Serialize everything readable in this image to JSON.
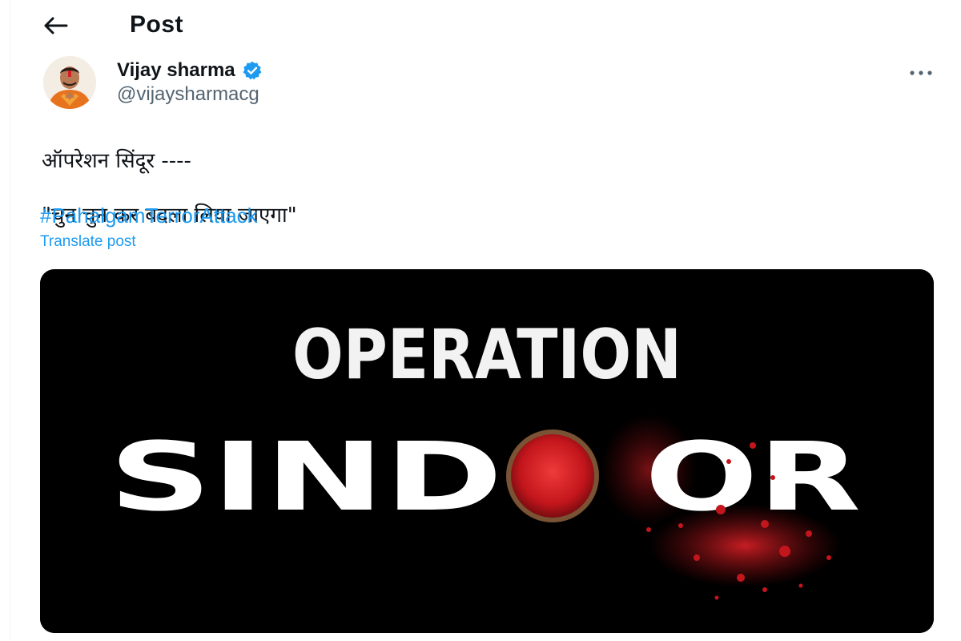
{
  "header": {
    "title": "Post",
    "back_icon": "arrow-left-icon"
  },
  "author": {
    "name": "Vijay sharma",
    "handle": "@vijaysharmacg",
    "verified": true,
    "verified_color": "#1d9bf0",
    "more_icon": "more-horizontal-icon"
  },
  "post": {
    "text_line1": "ऑपरेशन सिंदूर ----",
    "text_line2": "\"चुन चुन कर बदला लिया जाएगा\"",
    "hashtag": "#PahalgamTerrorAttack",
    "translate_label": "Translate post",
    "link_color": "#1d9bf0"
  },
  "media": {
    "line1": "OPERATION",
    "line2_part1": "SIND",
    "line2_part2": "OR",
    "background_color": "#000000",
    "accent_color": "#d01f25"
  }
}
